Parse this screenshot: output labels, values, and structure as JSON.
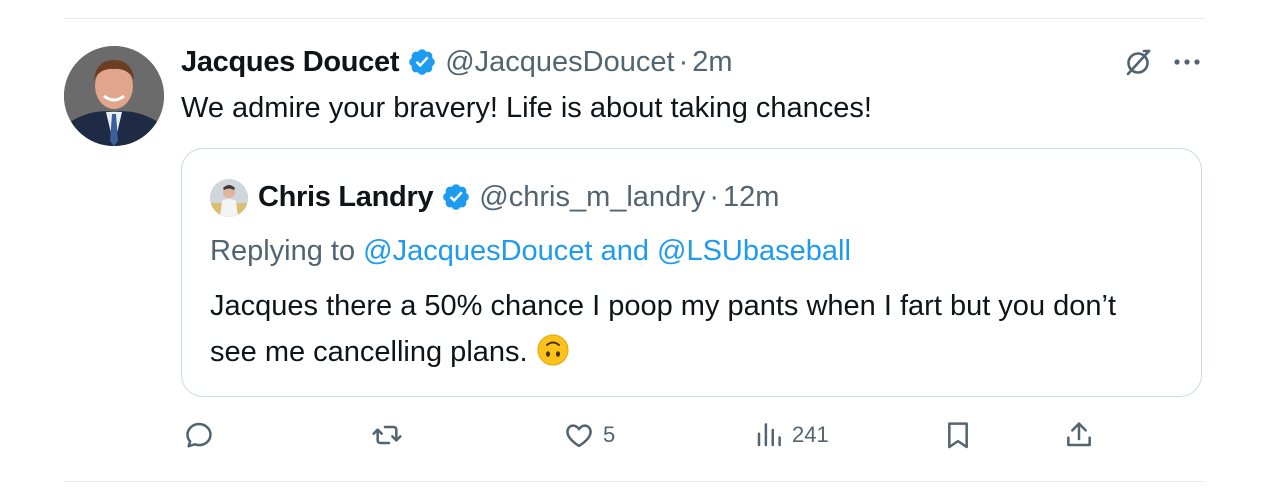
{
  "tweet": {
    "author": {
      "name": "Jacques Doucet",
      "handle": "@JacquesDoucet",
      "verified": true,
      "avatar": "avatar"
    },
    "separator": "·",
    "time": "2m",
    "text": "We admire your bravery! Life is about taking chances!",
    "icons": {
      "grok": "grok-icon",
      "more": "more-icon"
    }
  },
  "quote": {
    "author": {
      "name": "Chris Landry",
      "handle": "@chris_m_landry",
      "verified": true
    },
    "separator": "·",
    "time": "12m",
    "replying_prefix": "Replying to",
    "replying_mention_1": "@JacquesDoucet",
    "replying_conjunction": "and",
    "replying_mention_2": "@LSUbaseball",
    "text": "Jacques there a 50% chance I poop my pants when I fart but you don’t see me cancelling plans.",
    "emoji": "upside-down-face"
  },
  "actions": {
    "reply": {
      "icon": "reply-icon",
      "count": ""
    },
    "retweet": {
      "icon": "retweet-icon",
      "count": ""
    },
    "like": {
      "icon": "heart-icon",
      "count": "5"
    },
    "views": {
      "icon": "views-icon",
      "count": "241"
    },
    "bookmark": {
      "icon": "bookmark-icon",
      "count": ""
    },
    "share": {
      "icon": "share-icon",
      "count": ""
    }
  },
  "colors": {
    "text": "#0f1419",
    "secondary": "#536471",
    "accent": "#1d9bf0",
    "border": "#cfd9de",
    "divider": "#e7e9ea"
  }
}
